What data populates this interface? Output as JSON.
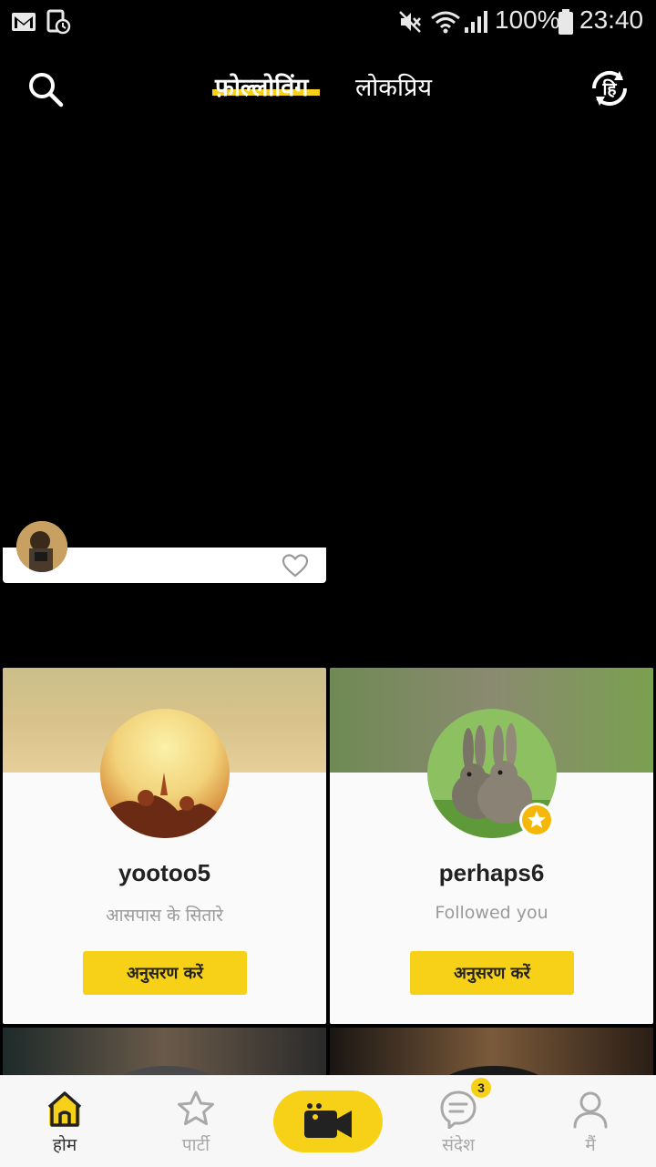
{
  "status_bar": {
    "battery": "100%",
    "time": "23:40",
    "icons": [
      "gmail-icon",
      "screenshot-notification-icon",
      "mute-icon",
      "wifi-icon",
      "signal-icon",
      "battery-icon"
    ]
  },
  "header": {
    "tabs": [
      {
        "label": "फ़ोल्लोविंग",
        "active": true
      },
      {
        "label": "लोकप्रिय",
        "active": false
      }
    ],
    "search_icon": "search-icon",
    "language_icon_label": "हि"
  },
  "suggestions": [
    {
      "username": "yootoo5",
      "subtitle": "आसपास के सितारे",
      "button_label": "अनुसरण करें"
    },
    {
      "username": "perhaps6",
      "subtitle": "Followed you",
      "button_label": "अनुसरण करें"
    }
  ],
  "bottom_nav": {
    "items": [
      {
        "label": "होम",
        "active": true,
        "icon": "home-icon"
      },
      {
        "label": "पार्टी",
        "active": false,
        "icon": "star-icon"
      },
      {
        "label": "संदेश",
        "active": false,
        "icon": "chat-icon",
        "badge": "3"
      },
      {
        "label": "मैं",
        "active": false,
        "icon": "profile-icon"
      }
    ],
    "live_icon": "video-camera-icon"
  },
  "colors": {
    "accent": "#f7d117",
    "background": "#000000",
    "card": "#fafafa"
  }
}
